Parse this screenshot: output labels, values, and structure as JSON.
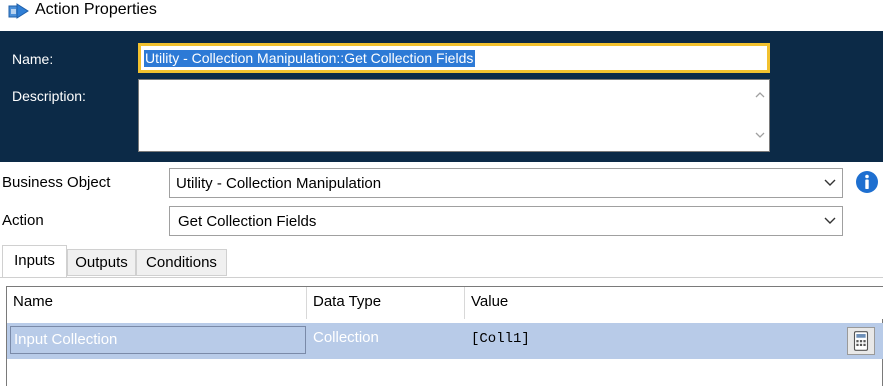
{
  "window": {
    "title": "Action Properties"
  },
  "header": {
    "name_label": "Name:",
    "name_value": "Utility - Collection Manipulation::Get Collection Fields",
    "description_label": "Description:",
    "description_value": ""
  },
  "fields": {
    "business_object_label": "Business Object",
    "business_object_value": "Utility - Collection Manipulation",
    "action_label": "Action",
    "action_value": "Get Collection Fields"
  },
  "tabs": [
    {
      "label": "Inputs",
      "active": true
    },
    {
      "label": "Outputs",
      "active": false
    },
    {
      "label": "Conditions",
      "active": false
    }
  ],
  "grid": {
    "columns": [
      "Name",
      "Data Type",
      "Value"
    ],
    "rows": [
      {
        "name": "Input Collection",
        "type": "Collection",
        "value": "[Coll1]"
      }
    ]
  },
  "colors": {
    "header_bg": "#0c2a47",
    "focus_border": "#f2c12e",
    "selection": "#2d7ad6",
    "row_selected": "#b8cbe8",
    "info_icon": "#1e6fd0"
  },
  "icons": {
    "title": "action-properties-icon",
    "info": "info-icon",
    "calculator": "calculator-icon",
    "dropdown": "chevron-down-icon"
  }
}
